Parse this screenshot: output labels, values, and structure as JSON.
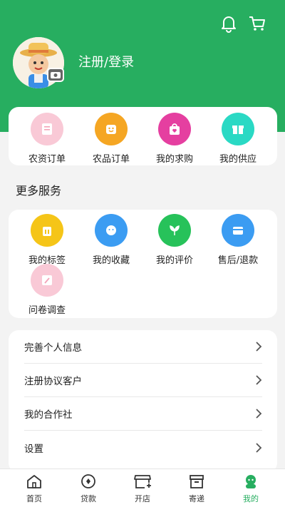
{
  "header": {
    "login_text": "注册/登录",
    "accent": "#27ae60"
  },
  "orders": [
    {
      "label": "农资订单",
      "icon": "document-icon",
      "color": "#f6b7c7"
    },
    {
      "label": "农品订单",
      "icon": "smile-bag-icon",
      "color": "#f5a623"
    },
    {
      "label": "我的求购",
      "icon": "shopping-bag-heart-icon",
      "color": "#e53fa0"
    },
    {
      "label": "我的供应",
      "icon": "gift-icon",
      "color": "#2ad9c4"
    }
  ],
  "more_services": {
    "title": "更多服务",
    "items": [
      {
        "label": "我的标签",
        "icon": "tag-icon",
        "color": "#f5c518"
      },
      {
        "label": "我的收藏",
        "icon": "favorite-face-icon",
        "color": "#3b9cf2"
      },
      {
        "label": "我的评价",
        "icon": "plant-icon",
        "color": "#27c25a"
      },
      {
        "label": "售后/退款",
        "icon": "refund-card-icon",
        "color": "#3b9cf2"
      },
      {
        "label": "问卷调查",
        "icon": "survey-icon",
        "color": "#f6b7c7"
      }
    ]
  },
  "menu": [
    {
      "label": "完善个人信息"
    },
    {
      "label": "注册协议客户"
    },
    {
      "label": "我的合作社"
    },
    {
      "label": "设置"
    }
  ],
  "tabbar": [
    {
      "label": "首页",
      "icon": "home-icon"
    },
    {
      "label": "贷款",
      "icon": "loan-icon"
    },
    {
      "label": "开店",
      "icon": "store-icon"
    },
    {
      "label": "寄递",
      "icon": "package-icon"
    },
    {
      "label": "我的",
      "icon": "profile-icon",
      "active": true
    }
  ]
}
